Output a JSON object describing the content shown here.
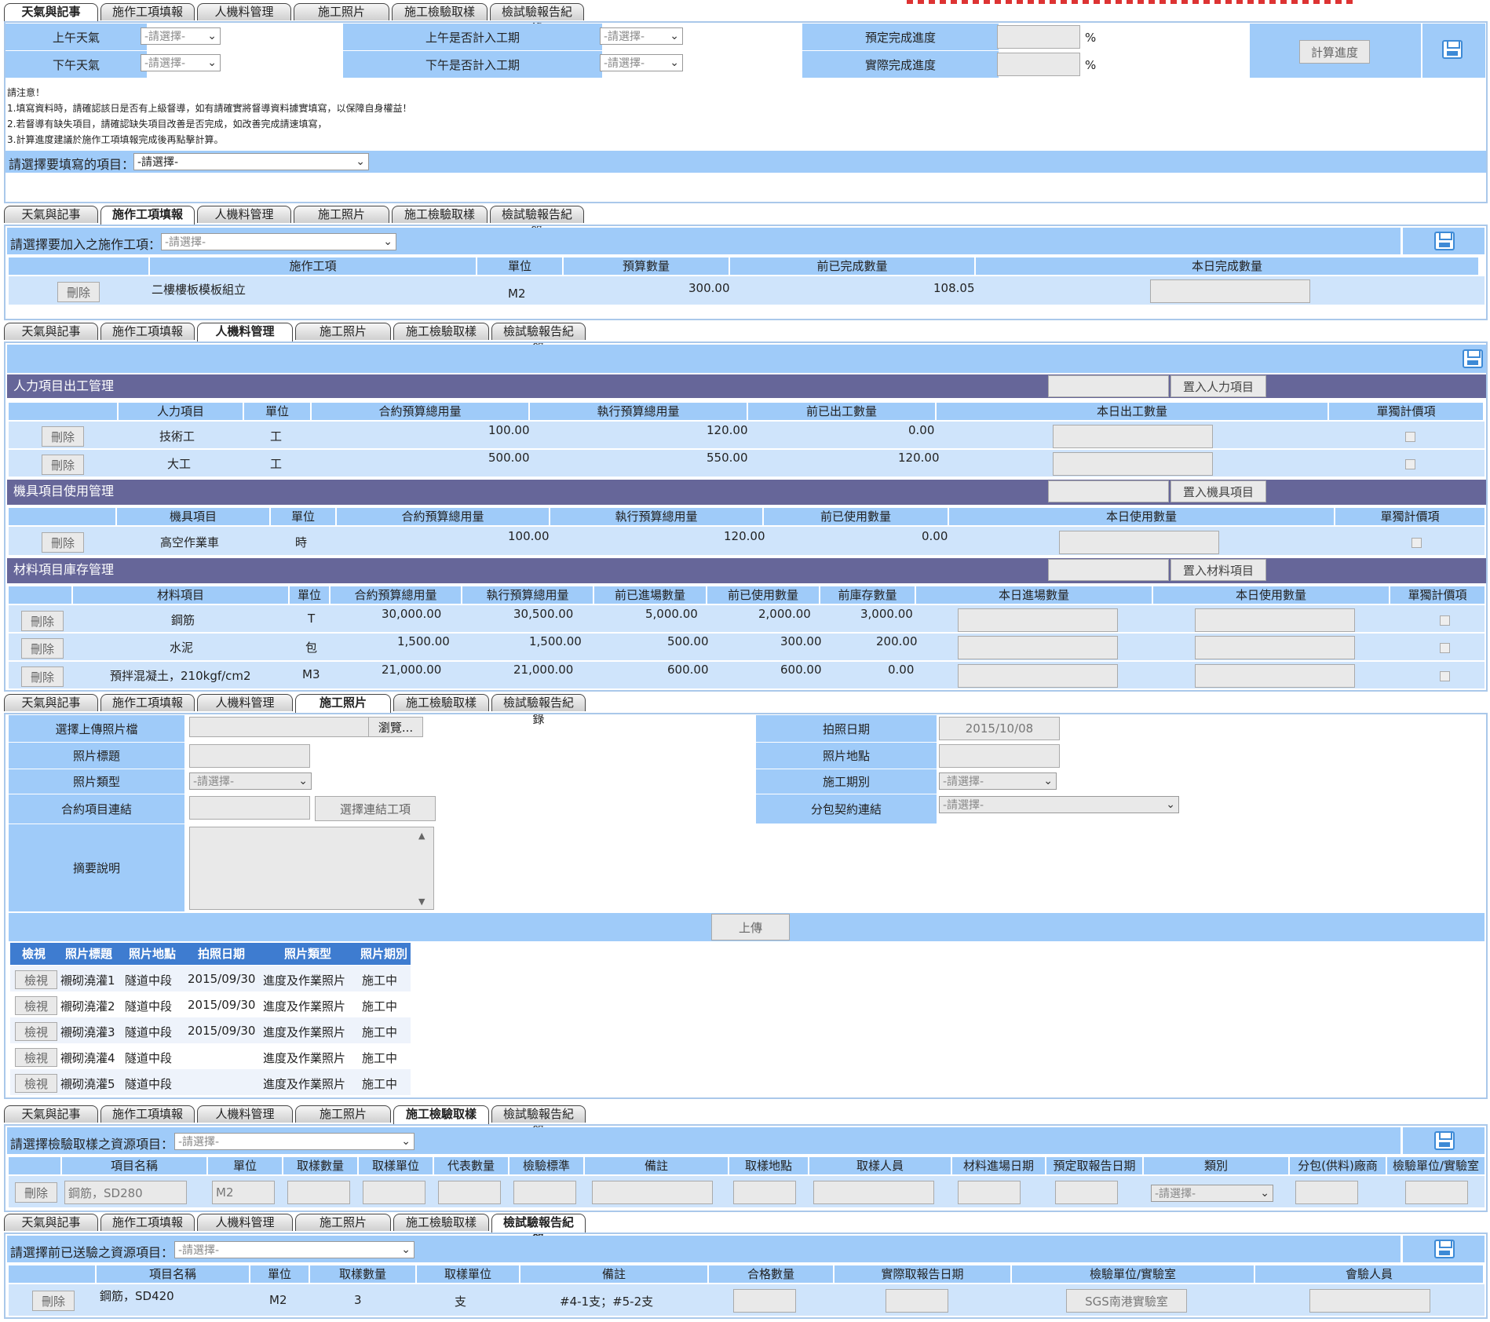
{
  "tabs": [
    "天氣與記事",
    "施作工項填報",
    "人機料管理",
    "施工照片",
    "施工檢驗取樣",
    "檢試驗報告紀錄"
  ],
  "weather": {
    "am_label": "上午天氣",
    "pm_label": "下午天氣",
    "select_placeholder": "-請選擇-",
    "am_count_label": "上午是否計入工期",
    "pm_count_label": "下午是否計入工期",
    "planned_label": "預定完成進度",
    "actual_label": "實際完成進度",
    "percent": "%",
    "calc_button": "計算進度",
    "notice_title": "請注意！",
    "notice_1": "1.填寫資料時，請確認該日是否有上級督導，如有請確實將督導資料據實填寫，以保障自身權益！",
    "notice_2": "2.若督導有缺失項目，請確認缺失項目改善是否完成，如改善完成請速填寫，",
    "notice_3": "3.計算進度建議於施作工項填報完成後再點擊計算。",
    "item_select_label": "請選擇要填寫的項目：",
    "item_select_value": "-請選擇-"
  },
  "works": {
    "select_label": "請選擇要加入之施作工項：",
    "select_value": "-請選擇-",
    "headers": [
      "施作工項",
      "單位",
      "預算數量",
      "前已完成數量",
      "本日完成數量"
    ],
    "delete": "刪除",
    "row": {
      "name": "二樓樓板模板組立",
      "unit": "M2",
      "budget": "300.00",
      "prev": "108.05"
    }
  },
  "resources": {
    "labor_title": "人力項目出工管理",
    "labor_btn": "置入人力項目",
    "labor_headers": [
      "人力項目",
      "單位",
      "合約預算總用量",
      "執行預算總用量",
      "前已出工數量",
      "本日出工數量",
      "單獨計價項"
    ],
    "labor_rows": [
      {
        "name": "技術工",
        "unit": "工",
        "contract": "100.00",
        "exec": "120.00",
        "prev": "0.00"
      },
      {
        "name": "大工",
        "unit": "工",
        "contract": "500.00",
        "exec": "550.00",
        "prev": "120.00"
      }
    ],
    "equip_title": "機具項目使用管理",
    "equip_btn": "置入機具項目",
    "equip_headers": [
      "機具項目",
      "單位",
      "合約預算總用量",
      "執行預算總用量",
      "前已使用數量",
      "本日使用數量",
      "單獨計價項"
    ],
    "equip_rows": [
      {
        "name": "高空作業車",
        "unit": "時",
        "contract": "100.00",
        "exec": "120.00",
        "prev": "0.00"
      }
    ],
    "mat_title": "材料項目庫存管理",
    "mat_btn": "置入材料項目",
    "mat_headers": [
      "材料項目",
      "單位",
      "合約預算總用量",
      "執行預算總用量",
      "前已進場數量",
      "前已使用數量",
      "前庫存數量",
      "本日進場數量",
      "本日使用數量",
      "單獨計價項"
    ],
    "mat_rows": [
      {
        "name": "鋼筋",
        "unit": "T",
        "contract": "30,000.00",
        "exec": "30,500.00",
        "in": "5,000.00",
        "used": "2,000.00",
        "stock": "3,000.00"
      },
      {
        "name": "水泥",
        "unit": "包",
        "contract": "1,500.00",
        "exec": "1,500.00",
        "in": "500.00",
        "used": "300.00",
        "stock": "200.00"
      },
      {
        "name": "預拌混凝土，210kgf/cm2",
        "unit": "M3",
        "contract": "21,000.00",
        "exec": "21,000.00",
        "in": "600.00",
        "used": "600.00",
        "stock": "0.00"
      }
    ]
  },
  "photos": {
    "file_label": "選擇上傳照片檔",
    "browse": "瀏覽...",
    "title_label": "照片標題",
    "type_label": "照片類型",
    "contract_label": "合約項目連結",
    "link_btn": "選擇連結工項",
    "desc_label": "摘要說明",
    "date_label": "拍照日期",
    "date_value": "2015/10/08",
    "place_label": "照片地點",
    "period_label": "施工期別",
    "sub_label": "分包契約連結",
    "select_value": "-請選擇-",
    "upload": "上傳",
    "list_headers": [
      "檢視",
      "照片標題",
      "照片地點",
      "拍照日期",
      "照片類型",
      "照片期別"
    ],
    "view": "檢視",
    "rows": [
      {
        "title": "襯砌澆灌1",
        "place": "隧道中段",
        "date": "2015/09/30",
        "type": "進度及作業照片",
        "period": "施工中"
      },
      {
        "title": "襯砌澆灌2",
        "place": "隧道中段",
        "date": "2015/09/30",
        "type": "進度及作業照片",
        "period": "施工中"
      },
      {
        "title": "襯砌澆灌3",
        "place": "隧道中段",
        "date": "2015/09/30",
        "type": "進度及作業照片",
        "period": "施工中"
      },
      {
        "title": "襯砌澆灌4",
        "place": "隧道中段",
        "date": "",
        "type": "進度及作業照片",
        "period": "施工中"
      },
      {
        "title": "襯砌澆灌5",
        "place": "隧道中段",
        "date": "",
        "type": "進度及作業照片",
        "period": "施工中"
      }
    ]
  },
  "sampling": {
    "select_label": "請選擇檢驗取樣之資源項目：",
    "select_value": "-請選擇-",
    "headers": [
      "項目名稱",
      "單位",
      "取樣數量",
      "取樣單位",
      "代表數量",
      "檢驗標準",
      "備註",
      "取樣地點",
      "取樣人員",
      "材料進場日期",
      "預定取報告日期",
      "類別",
      "分包(供料)廠商",
      "檢驗單位/實驗室"
    ],
    "delete": "刪除",
    "row_name": "鋼筋，SD280",
    "row_unit": "M2",
    "row_type": "-請選擇-"
  },
  "reports": {
    "select_label": "請選擇前已送驗之資源項目：",
    "select_value": "-請選擇-",
    "headers": [
      "項目名稱",
      "單位",
      "取樣數量",
      "取樣單位",
      "備註",
      "合格數量",
      "實際取報告日期",
      "檢驗單位/實驗室",
      "會驗人員"
    ],
    "delete": "刪除",
    "row": {
      "name": "鋼筋，SD420",
      "unit": "M2",
      "qty": "3",
      "sunit": "支",
      "note": "#4-1支；#5-2支",
      "lab": "SGS南港實驗室"
    }
  },
  "colors": {
    "header_blue": "#9fcbf9",
    "section_purple": "#666699"
  }
}
